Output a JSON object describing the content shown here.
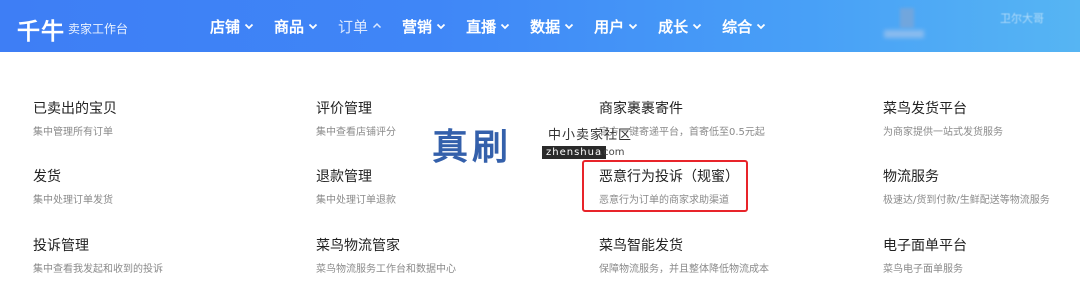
{
  "header": {
    "logo": "千牛",
    "logo_subtitle": "卖家工作台",
    "user_name": "卫尔大哥",
    "nav": [
      {
        "label": "店铺",
        "active": false
      },
      {
        "label": "商品",
        "active": false
      },
      {
        "label": "订单",
        "active": true
      },
      {
        "label": "营销",
        "active": false
      },
      {
        "label": "直播",
        "active": false
      },
      {
        "label": "数据",
        "active": false
      },
      {
        "label": "用户",
        "active": false
      },
      {
        "label": "成长",
        "active": false
      },
      {
        "label": "综合",
        "active": false
      }
    ]
  },
  "menu": {
    "col1": [
      {
        "title": "已卖出的宝贝",
        "desc": "集中管理所有订单"
      },
      {
        "title": "发货",
        "desc": "集中处理订单发货"
      },
      {
        "title": "投诉管理",
        "desc": "集中查看我发起和收到的投诉"
      }
    ],
    "col2": [
      {
        "title": "评价管理",
        "desc": "集中查看店铺评分"
      },
      {
        "title": "退款管理",
        "desc": "集中处理订单退款"
      },
      {
        "title": "菜鸟物流管家",
        "desc": "菜鸟物流服务工作台和数据中心"
      }
    ],
    "col3": [
      {
        "title": "商家裹裹寄件",
        "desc": "官方一键寄递平台，首寄低至0.5元起"
      },
      {
        "title": "恶意行为投诉（规蜜）",
        "desc": "恶意行为订单的商家求助渠道"
      },
      {
        "title": "菜鸟智能发货",
        "desc": "保障物流服务，并且整体降低物流成本"
      }
    ],
    "col4": [
      {
        "title": "菜鸟发货平台",
        "desc": "为商家提供一站式发货服务"
      },
      {
        "title": "物流服务",
        "desc": "极速达/货到付款/生鲜配送等物流服务"
      },
      {
        "title": "电子面单平台",
        "desc": "菜鸟电子面单服务"
      }
    ]
  },
  "watermark": {
    "main": "真刷",
    "cn": "中小卖家社区",
    "site": "zhenshua",
    "suffix": ".com"
  },
  "colors": {
    "header_gradient_start": "#3e7ef5",
    "header_gradient_end": "#56b5f3",
    "highlight_border": "#e8242a"
  }
}
